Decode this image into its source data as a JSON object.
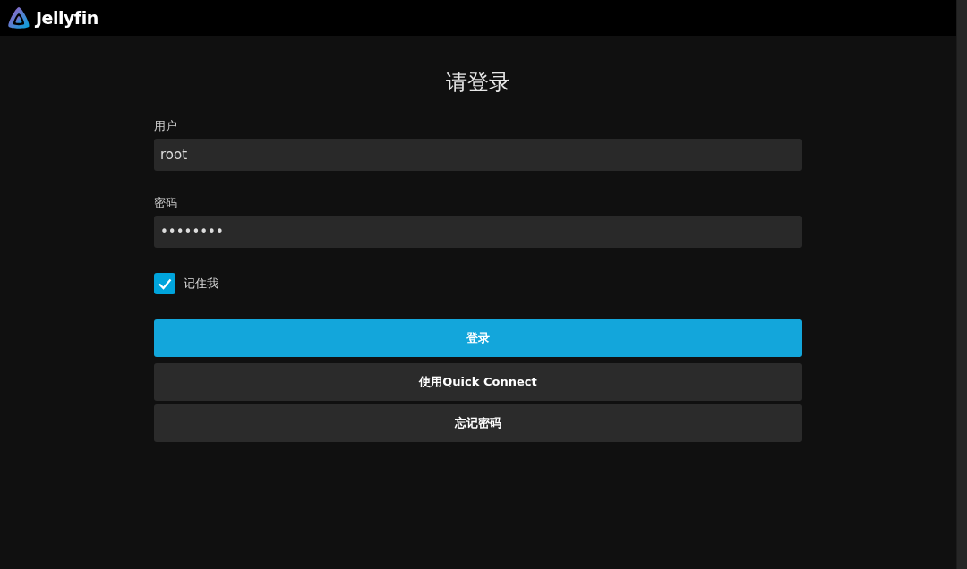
{
  "header": {
    "brand": "Jellyfin"
  },
  "login": {
    "title": "请登录",
    "fields": [
      {
        "label": "用户",
        "value": "root"
      },
      {
        "label": "密码",
        "value": "••••••••"
      }
    ],
    "remember": {
      "label": "记住我",
      "checked": true
    },
    "buttons": [
      {
        "label": "登录",
        "kind": "primary"
      },
      {
        "label": "使用Quick Connect",
        "kind": "secondary"
      },
      {
        "label": "忘记密码",
        "kind": "secondary"
      }
    ]
  }
}
